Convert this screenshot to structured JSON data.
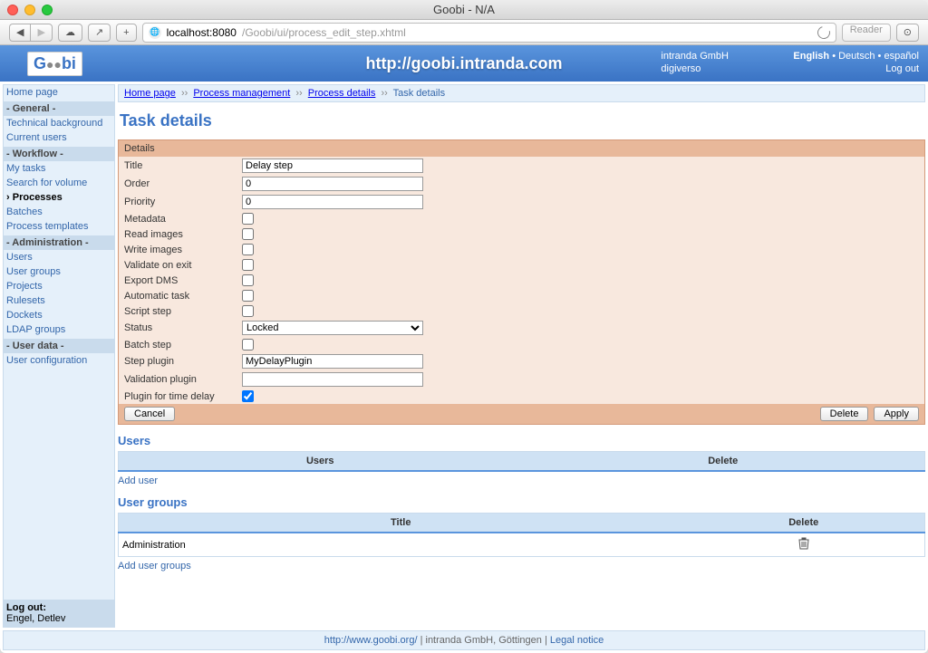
{
  "window": {
    "title": "Goobi - N/A",
    "url_host": "localhost:8080",
    "url_path": "/Goobi/ui/process_edit_step.xhtml",
    "reader": "Reader"
  },
  "header": {
    "logo_text": "Goobi",
    "center_url": "http://goobi.intranda.com",
    "company": "intranda GmbH",
    "tagline": "digiverso",
    "lang_en": "English",
    "lang_de": "Deutsch",
    "lang_es": "español",
    "logout": "Log out"
  },
  "sidebar": {
    "home": "Home page",
    "sections": {
      "general": "- General -",
      "workflow": "- Workflow -",
      "admin": "- Administration -",
      "userdata": "- User data -"
    },
    "general_items": [
      "Technical background",
      "Current users"
    ],
    "workflow_items": [
      "My tasks",
      "Search for volume",
      "Processes",
      "Batches",
      "Process templates"
    ],
    "workflow_active": "Processes",
    "admin_items": [
      "Users",
      "User groups",
      "Projects",
      "Rulesets",
      "Dockets",
      "LDAP groups"
    ],
    "userdata_items": [
      "User configuration"
    ],
    "logout_label": "Log out:",
    "logout_user": "Engel, Detlev"
  },
  "breadcrumb": {
    "items": [
      "Home page",
      "Process management",
      "Process details",
      "Task details"
    ],
    "sep": "››"
  },
  "page": {
    "title": "Task details"
  },
  "details": {
    "heading": "Details",
    "labels": {
      "title": "Title",
      "order": "Order",
      "priority": "Priority",
      "metadata": "Metadata",
      "read_images": "Read images",
      "write_images": "Write images",
      "validate_on_exit": "Validate on exit",
      "export_dms": "Export DMS",
      "automatic_task": "Automatic task",
      "script_step": "Script step",
      "status": "Status",
      "batch_step": "Batch step",
      "step_plugin": "Step plugin",
      "validation_plugin": "Validation plugin",
      "plugin_time_delay": "Plugin for time delay"
    },
    "values": {
      "title": "Delay step",
      "order": "0",
      "priority": "0",
      "metadata": false,
      "read_images": false,
      "write_images": false,
      "validate_on_exit": false,
      "export_dms": false,
      "automatic_task": false,
      "script_step": false,
      "status": "Locked",
      "batch_step": false,
      "step_plugin": "MyDelayPlugin",
      "validation_plugin": "",
      "plugin_time_delay": true
    },
    "buttons": {
      "cancel": "Cancel",
      "delete": "Delete",
      "apply": "Apply"
    }
  },
  "users": {
    "title": "Users",
    "col_users": "Users",
    "col_delete": "Delete",
    "add": "Add user"
  },
  "usergroups": {
    "title": "User groups",
    "col_title": "Title",
    "col_delete": "Delete",
    "rows": [
      {
        "title": "Administration"
      }
    ],
    "add": "Add user groups"
  },
  "footer": {
    "goobi_url": "http://www.goobi.org/",
    "company": "intranda GmbH, Göttingen",
    "legal": "Legal notice",
    "sep": " | "
  }
}
